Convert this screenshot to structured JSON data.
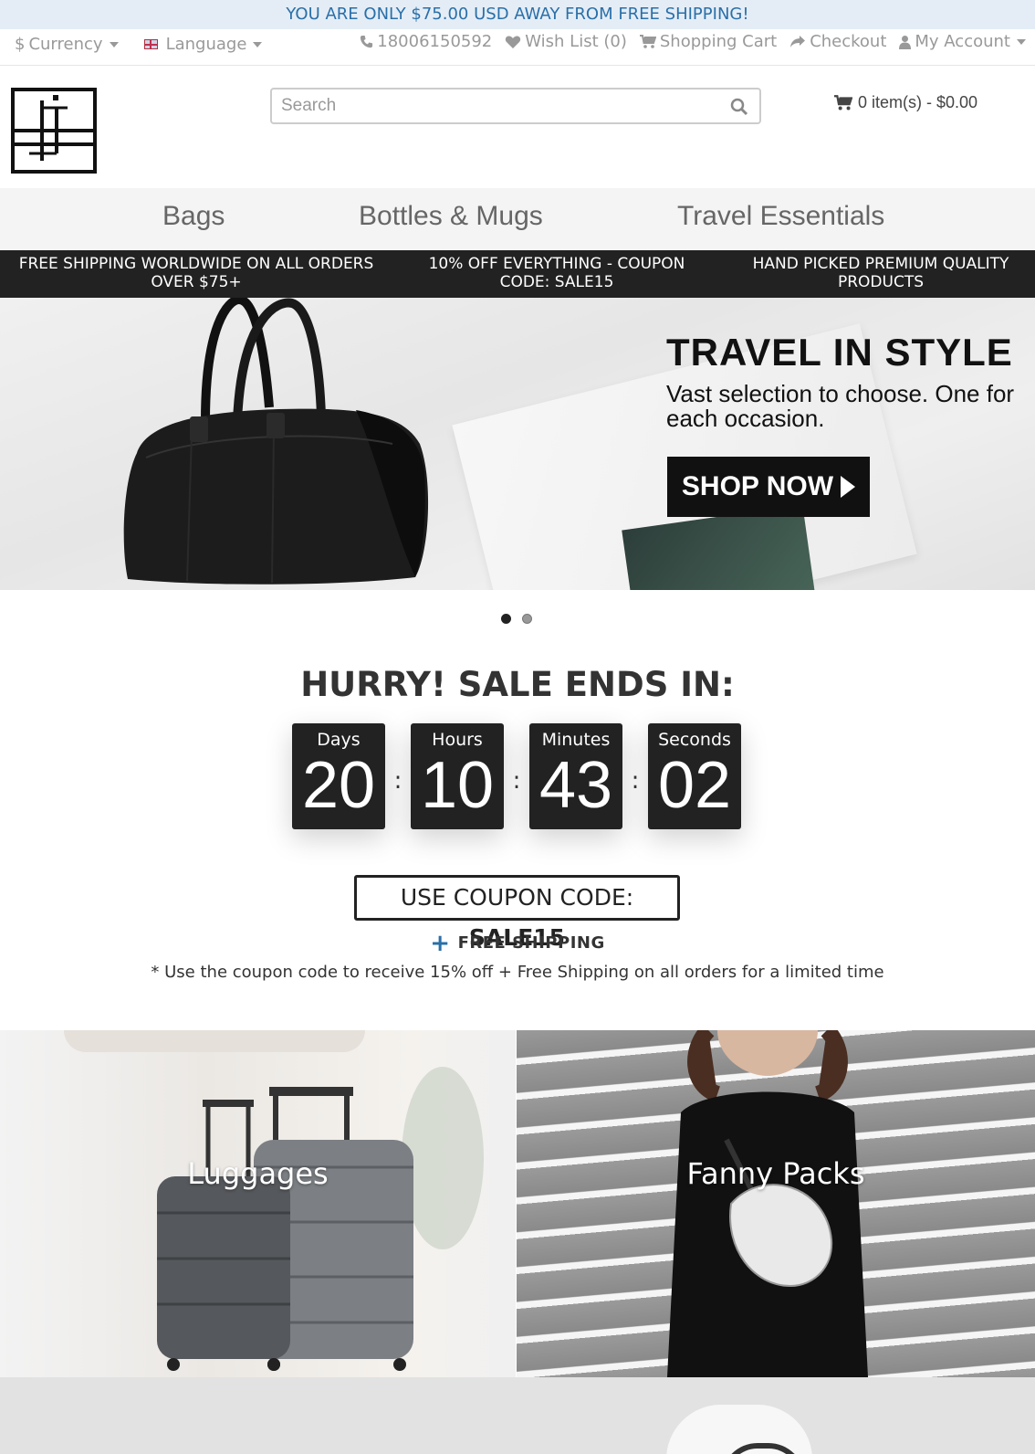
{
  "promo": {
    "text": "YOU ARE ONLY $75.00 USD AWAY FROM FREE SHIPPING!"
  },
  "top_bar": {
    "currency_label": "Currency",
    "language_label": "Language",
    "phone": "18006150592",
    "wishlist": "Wish List (0)",
    "cart": "Shopping Cart",
    "checkout": "Checkout",
    "account": "My Account"
  },
  "header": {
    "search_placeholder": "Search",
    "cart_summary": "0 item(s) - $0.00"
  },
  "nav": {
    "items": [
      "Bags",
      "Bottles & Mugs",
      "Travel Essentials"
    ]
  },
  "usp": {
    "items": [
      "FREE SHIPPING WORLDWIDE ON ALL ORDERS OVER $75+",
      "10% OFF EVERYTHING - COUPON CODE: SALE15",
      "HAND PICKED PREMIUM QUALITY PRODUCTS"
    ]
  },
  "hero": {
    "title": "TRAVEL IN STYLE",
    "subtitle": "Vast selection to choose. One for each occasion.",
    "cta": "SHOP NOW",
    "slides_total": 2,
    "active_slide": 1
  },
  "countdown": {
    "title": "HURRY! SALE ENDS IN:",
    "days_label": "Days",
    "days": "20",
    "hours_label": "Hours",
    "hours": "10",
    "minutes_label": "Minutes",
    "minutes": "43",
    "seconds_label": "Seconds",
    "seconds": "02",
    "separator": ":"
  },
  "coupon": {
    "prefix": "USE COUPON CODE:",
    "code": "SALE15",
    "plus": "+",
    "free_shipping": "FREE SHIPPING",
    "note": "* Use the coupon code to receive 15% off + Free Shipping on all orders for a limited time"
  },
  "categories": {
    "luggage": "Luggages",
    "fanny": "Fanny Packs"
  },
  "colors": {
    "accent": "#2a6fa8",
    "dark": "#222222",
    "promo_bg": "#e4edf6"
  }
}
